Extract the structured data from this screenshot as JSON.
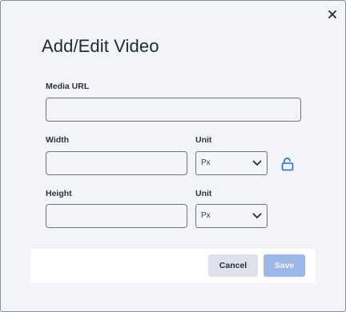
{
  "dialog": {
    "title": "Add/Edit Video"
  },
  "fields": {
    "media_url": {
      "label": "Media URL",
      "value": ""
    },
    "width": {
      "label": "Width",
      "value": ""
    },
    "width_unit": {
      "label": "Unit",
      "value": "Px"
    },
    "height": {
      "label": "Height",
      "value": ""
    },
    "height_unit": {
      "label": "Unit",
      "value": "Px"
    }
  },
  "buttons": {
    "cancel": "Cancel",
    "save": "Save"
  },
  "icons": {
    "close": "close-icon",
    "lock": "unlock-icon",
    "chevron": "chevron-down-icon"
  },
  "colors": {
    "accent": "#1d6fd1",
    "save_disabled": "#9db8e8"
  }
}
